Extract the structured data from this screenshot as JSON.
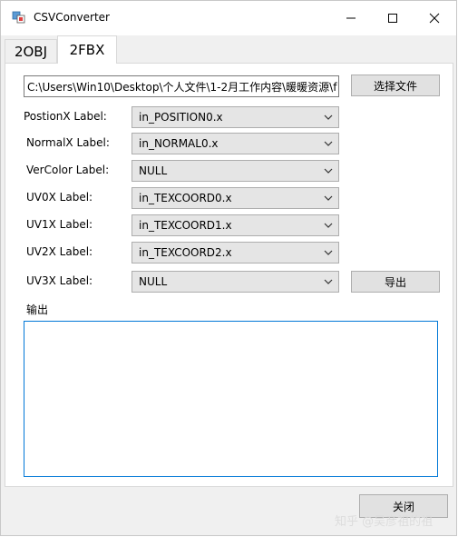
{
  "window": {
    "title": "CSVConverter"
  },
  "tabs": [
    {
      "label": "2OBJ",
      "active": false
    },
    {
      "label": "2FBX",
      "active": true
    }
  ],
  "file": {
    "path": "C:\\Users\\Win10\\Desktop\\个人文件\\1-2月工作内容\\暖暖资源\\f",
    "select_button": "选择文件"
  },
  "fields": [
    {
      "label": "PostionX Label:",
      "value": "in_POSITION0.x"
    },
    {
      "label": "NormalX Label:",
      "value": "in_NORMAL0.x"
    },
    {
      "label": "VerColor Label:",
      "value": "NULL"
    },
    {
      "label": "UV0X Label:",
      "value": "in_TEXCOORD0.x"
    },
    {
      "label": "UV1X Label:",
      "value": "in_TEXCOORD1.x"
    },
    {
      "label": "UV2X Label:",
      "value": "in_TEXCOORD2.x"
    },
    {
      "label": "UV3X Label:",
      "value": "NULL"
    }
  ],
  "export_button": "导出",
  "output": {
    "label": "输出",
    "text": ""
  },
  "close_button": "关闭",
  "watermark": "知乎 @吴彦祖的祖",
  "colors": {
    "accent": "#0078d7",
    "button_bg": "#e1e1e1",
    "combo_bg": "#e5e5e5"
  }
}
